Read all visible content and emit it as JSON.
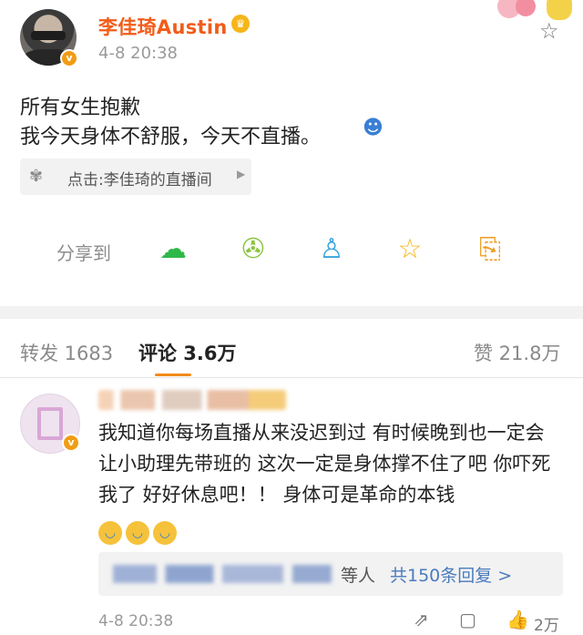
{
  "post": {
    "author": "李佳琦Austin",
    "time": "4-8 20:38",
    "line1": "所有女生抱歉",
    "line2": "我今天身体不舒服，今天不直播。",
    "live_card_label": "点击:李佳琦的直播间",
    "share_label": "分享到",
    "icons": [
      "verified-badge-icon",
      "crown-badge-icon",
      "star-icon",
      "wechat-icon",
      "moments-icon",
      "qq-icon",
      "qzone-icon",
      "save-image-icon"
    ]
  },
  "tabs": {
    "repost": "转发 1683",
    "comment": "评论 3.6万",
    "like": "赞 21.8万"
  },
  "comment": {
    "text": "我知道你每场直播从来没迟到过 有时候晚到也一定会让小助理先带班的 这次一定是身体撑不住了吧 你吓死我了 好好休息吧！！ 身体可是革命的本钱",
    "reply_suffix": "等人",
    "reply_link": "共150条回复 >",
    "time": "4-8 20:38",
    "like_count": "2万"
  },
  "colors": {
    "username": "#f25c19",
    "link": "#4a7bbf",
    "tab_underline": "#f28b1b"
  }
}
